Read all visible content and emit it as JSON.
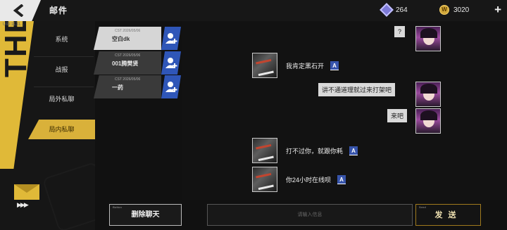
{
  "header": {
    "title": "邮件",
    "gems": "264",
    "coins": "3020",
    "coin_symbol": "W",
    "version_code": "UID:1131..."
  },
  "sidebar": {
    "items": [
      {
        "label": "系统",
        "active": false
      },
      {
        "label": "战报",
        "active": false
      },
      {
        "label": "局外私聊",
        "active": false
      },
      {
        "label": "局内私聊",
        "active": true
      }
    ],
    "banner_text": "THE WAR",
    "mail_arrows": "▶▶▶"
  },
  "contacts": [
    {
      "date": "CST 2026/05/06",
      "name": "空白dk",
      "active": true
    },
    {
      "date": "CST 2026/05/06",
      "name": "001腾樊贤",
      "active": false
    },
    {
      "date": "CST 2026/05/06",
      "name": "一药",
      "active": false
    }
  ],
  "messages": [
    {
      "side": "npc",
      "text": "?"
    },
    {
      "side": "player",
      "text": "我肯定黑石开",
      "translate": "A"
    },
    {
      "side": "npc",
      "text": "讲不通道理就过来打架吧"
    },
    {
      "side": "npc",
      "text": "来吧"
    },
    {
      "side": "player",
      "text": "打不过你，就跟你耗",
      "translate": "A"
    },
    {
      "side": "player",
      "text": "你24小时在线呗",
      "translate": "A"
    }
  ],
  "footer": {
    "delete_label": "删除聊天",
    "delete_caption": "Button",
    "input_placeholder": "请输入信息",
    "send_label": "发送",
    "send_caption": "Send"
  }
}
